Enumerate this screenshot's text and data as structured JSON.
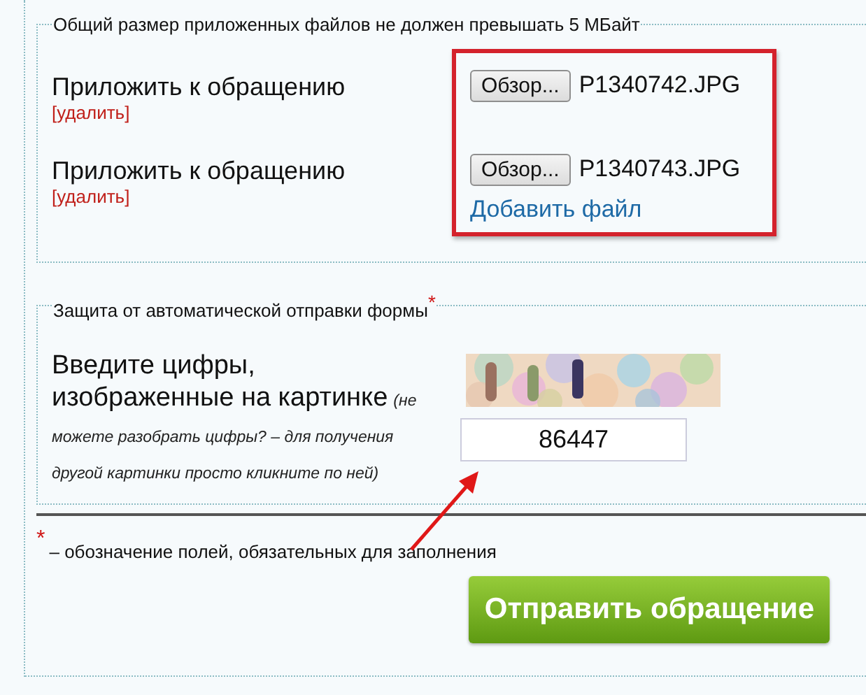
{
  "attachments": {
    "legend": "Общий размер приложенных файлов не должен превышать 5 МБайт",
    "rows": [
      {
        "label": "Приложить к обращению",
        "remove": "[удалить]",
        "browse": "Обзор...",
        "file": "P1340742.JPG"
      },
      {
        "label": "Приложить к обращению",
        "remove": "[удалить]",
        "browse": "Обзор...",
        "file": "P1340743.JPG"
      }
    ],
    "add_file": "Добавить файл"
  },
  "captcha": {
    "legend": "Защита от автоматической отправки формы",
    "required_mark": "*",
    "label": "Введите цифры, изображенные на картинке",
    "hint": "(не можете разобрать цифры? – для получения другой картинки просто кликните по ней)",
    "value": "86447"
  },
  "footnote": {
    "mark": "*",
    "text": "– обозначение полей, обязательных для заполнения"
  },
  "submit": "Отправить обращение"
}
